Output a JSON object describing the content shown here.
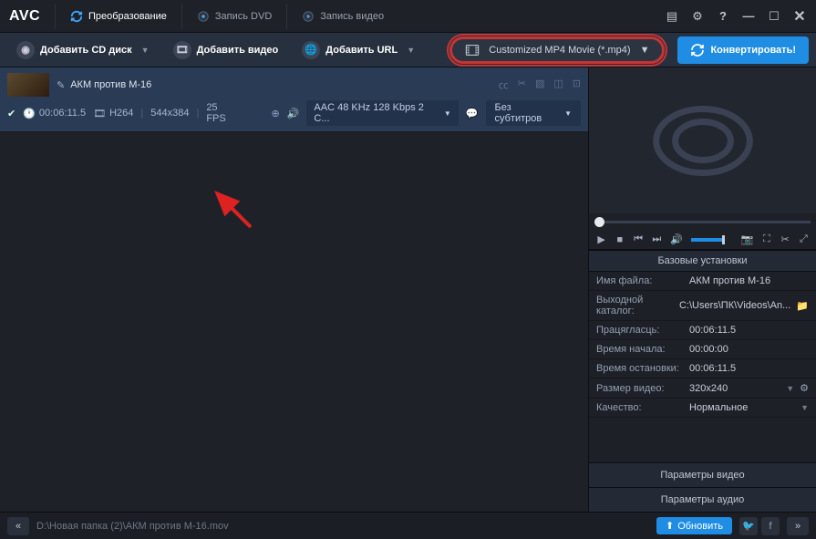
{
  "app": {
    "logo": "AVC"
  },
  "tabs": {
    "convert": "Преобразование",
    "dvd": "Запись DVD",
    "capture": "Запись видео"
  },
  "toolbar": {
    "add_cd": "Добавить CD диск",
    "add_video": "Добавить видео",
    "add_url": "Добавить URL",
    "format": "Customized MP4 Movie (*.mp4)",
    "convert": "Конвертировать!"
  },
  "item": {
    "title": "АКМ против М-16",
    "duration": "00:06:11.5",
    "vcodec": "H264",
    "res": "544x384",
    "fps": "25 FPS",
    "audio": "AAC 48 KHz 128 Kbps 2 C...",
    "subtitle": "Без субтитров"
  },
  "settings": {
    "header": "Базовые установки",
    "rows": {
      "filename": {
        "label": "Имя файла:",
        "value": "АКМ против М-16"
      },
      "output": {
        "label": "Выходной каталог:",
        "value": "C:\\Users\\ПК\\Videos\\An..."
      },
      "duration": {
        "label": "Працягласць:",
        "value": "00:06:11.5"
      },
      "start": {
        "label": "Время начала:",
        "value": "00:00:00"
      },
      "stop": {
        "label": "Время остановки:",
        "value": "00:06:11.5"
      },
      "size": {
        "label": "Размер видео:",
        "value": "320x240"
      },
      "quality": {
        "label": "Качество:",
        "value": "Нормальное"
      }
    },
    "video_params": "Параметры видео",
    "audio_params": "Параметры аудио"
  },
  "status": {
    "path": "D:\\Новая папка (2)\\АКМ против М-16.mov",
    "update": "Обновить"
  }
}
